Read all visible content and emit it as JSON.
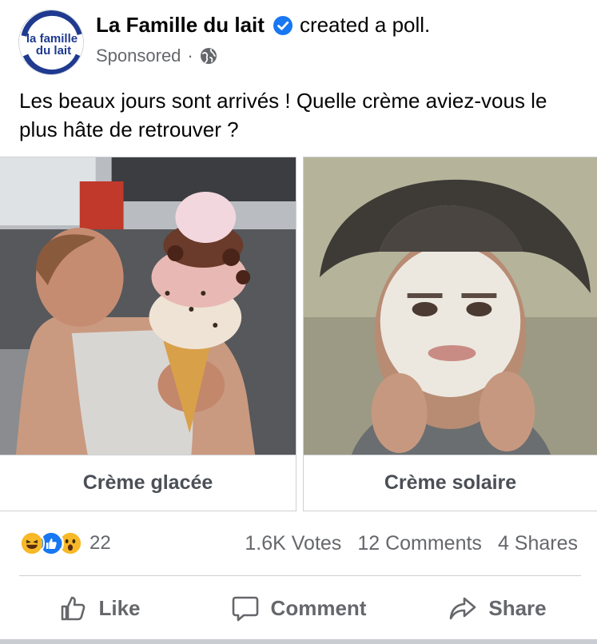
{
  "post": {
    "page_name": "La Famille du lait",
    "action": "created a poll.",
    "sponsored": "Sponsored",
    "separator": "·",
    "privacy_icon": "globe-icon",
    "avatar_logo": {
      "line1": "la famille",
      "line2": "du lait"
    },
    "text": "Les beaux jours sont arrivés ! Quelle crème aviez-vous le plus hâte de retrouver ?"
  },
  "poll": {
    "options": [
      {
        "label": "Crème glacée",
        "image": "man-with-giant-ice-cream-cone"
      },
      {
        "label": "Crème solaire",
        "image": "man-in-hat-with-sunscreen-on-face"
      }
    ]
  },
  "engagement": {
    "reactions": [
      "haha-icon",
      "like-icon",
      "wow-icon"
    ],
    "reaction_count": "22",
    "votes": "1.6K Votes",
    "comments": "12 Comments",
    "shares": "4 Shares"
  },
  "actions": {
    "like": "Like",
    "comment": "Comment",
    "share": "Share"
  },
  "colors": {
    "brand_blue": "#1877f2",
    "logo_navy": "#1f3a8f",
    "secondary_text": "#65676b"
  }
}
